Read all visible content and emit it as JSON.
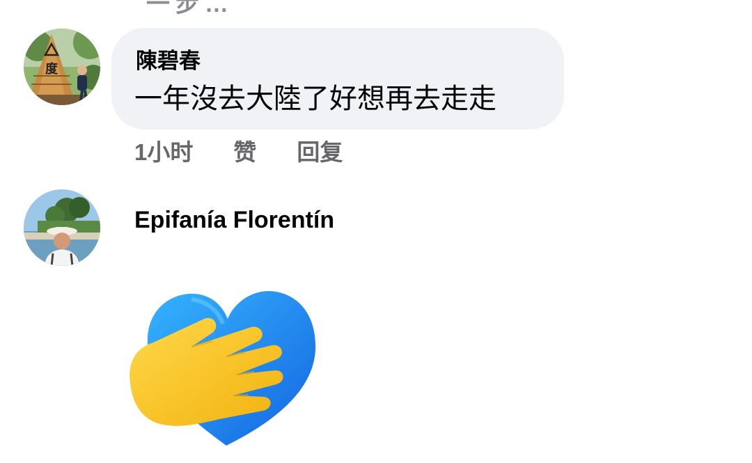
{
  "cut_off_text": "一步…",
  "comments": [
    {
      "author": "陳碧春",
      "text": "一年沒去大陸了好想再去走走",
      "time": "1小时",
      "like_label": "赞",
      "reply_label": "回复",
      "avatar_sign_text": "度"
    },
    {
      "author": "Epifanía Florentín",
      "sticker": "heart-with-hand"
    }
  ],
  "colors": {
    "bubble_bg": "#f0f2f5",
    "meta_text": "#65676b",
    "heart_blue": "#1e8ff0",
    "hand_yellow": "#f9c21a"
  }
}
